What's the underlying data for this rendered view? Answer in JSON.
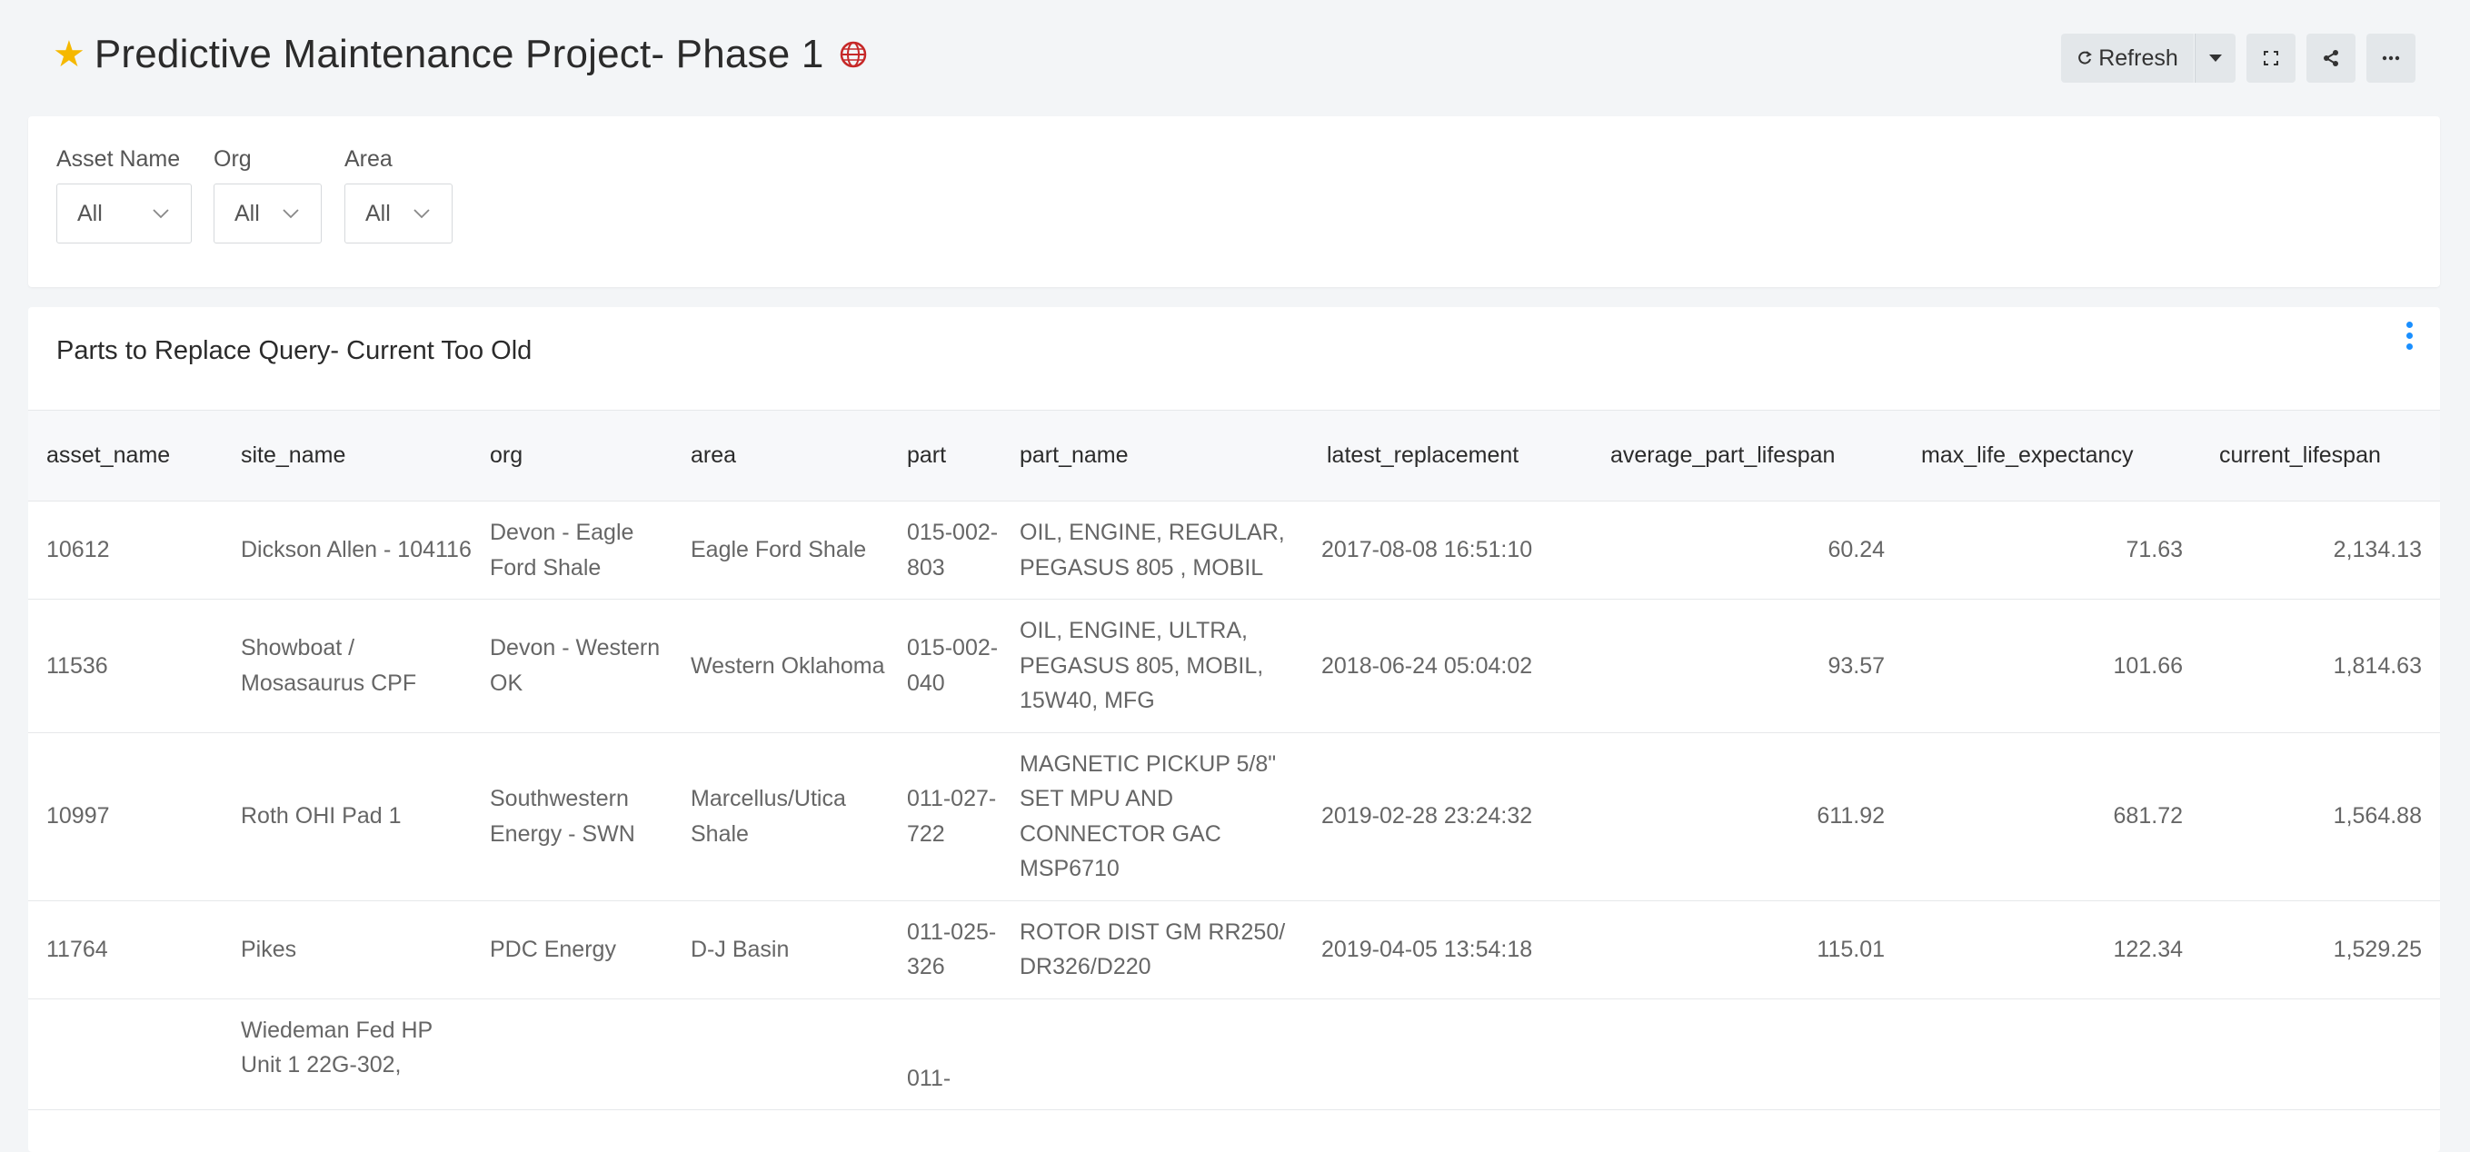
{
  "dashboard": {
    "title": "Predictive Maintenance Project- Phase 1",
    "star_icon": "star-icon",
    "globe_icon": "globe-icon",
    "accent_color": "#1a8fff",
    "star_color": "#f5b800"
  },
  "toolbar": {
    "refresh_label": "Refresh",
    "refresh_icon": "refresh-icon",
    "dropdown_icon": "caret-down-icon",
    "fullscreen_icon": "fullscreen-icon",
    "share_icon": "share-icon",
    "more_icon": "more-horizontal-icon"
  },
  "filters": {
    "asset_name": {
      "label": "Asset Name",
      "value": "All"
    },
    "org": {
      "label": "Org",
      "value": "All"
    },
    "area": {
      "label": "Area",
      "value": "All"
    }
  },
  "panel": {
    "title": "Parts to Replace Query- Current Too Old",
    "menu_icon": "kebab-menu-icon"
  },
  "table": {
    "columns": [
      "asset_name",
      "site_name",
      "org",
      "area",
      "part",
      "part_name",
      "latest_replacement",
      "average_part_lifespan",
      "max_life_expectancy",
      "current_lifespan"
    ],
    "rows": [
      [
        "10612",
        "Dickson Allen - 104116",
        "Devon - Eagle Ford Shale",
        "Eagle Ford Shale",
        "015-002-803",
        "OIL, ENGINE, REGULAR, PEGASUS 805 , MOBIL",
        "2017-08-08 16:51:10",
        "60.24",
        "71.63",
        "2,134.13"
      ],
      [
        "11536",
        "Showboat / Mosasaurus CPF",
        "Devon - Western OK",
        "Western Oklahoma",
        "015-002-040",
        "OIL, ENGINE, ULTRA, PEGASUS 805, MOBIL, 15W40, MFG",
        "2018-06-24 05:04:02",
        "93.57",
        "101.66",
        "1,814.63"
      ],
      [
        "10997",
        "Roth OHI Pad 1",
        "Southwestern Energy - SWN",
        "Marcellus/Utica Shale",
        "011-027-722",
        "MAGNETIC PICKUP 5/8\" SET MPU AND CONNECTOR GAC MSP6710",
        "2019-02-28 23:24:32",
        "611.92",
        "681.72",
        "1,564.88"
      ],
      [
        "11764",
        "Pikes",
        "PDC Energy",
        "D-J Basin",
        "011-025-326",
        "ROTOR DIST GM RR250/ DR326/D220",
        "2019-04-05 13:54:18",
        "115.01",
        "122.34",
        "1,529.25"
      ],
      [
        "",
        "Wiedeman Fed HP Unit 1 22G-302,",
        "",
        "",
        "011-",
        "",
        "",
        "",
        "",
        ""
      ]
    ]
  }
}
